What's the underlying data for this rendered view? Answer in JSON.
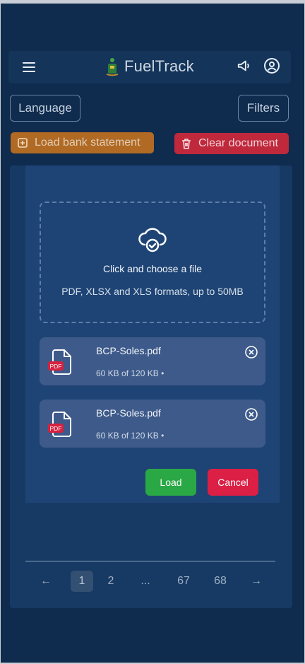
{
  "app": {
    "title": "FuelTrack"
  },
  "toolbar": {
    "language_label": "Language",
    "filters_label": "Filters"
  },
  "actions": {
    "load_statement_label": "Load bank statement",
    "clear_document_label": "Clear document",
    "load_color": "#b06a24",
    "clear_color": "#c0283c"
  },
  "upload": {
    "title": "Click and choose a file",
    "subtitle": "PDF, XLSX and XLS formats, up to 50MB"
  },
  "files": [
    {
      "name": "BCP-Soles.pdf",
      "meta": "60 KB of 120 KB •",
      "badge": "PDF"
    },
    {
      "name": "BCP-Soles.pdf",
      "meta": "60 KB of 120 KB •",
      "badge": "PDF"
    }
  ],
  "modal": {
    "load_label": "Load",
    "cancel_label": "Cancel",
    "load_color": "#2aa845",
    "cancel_color": "#dc1f45"
  },
  "pagination": {
    "prev": "←",
    "next": "→",
    "pages": [
      "1",
      "2",
      "...",
      "67",
      "68"
    ],
    "active": "1"
  },
  "icons": {
    "menu": "hamburger-icon",
    "announce": "megaphone-icon",
    "user": "user-circle-icon",
    "upload": "cloud-check-icon",
    "close": "close-circle-icon"
  }
}
